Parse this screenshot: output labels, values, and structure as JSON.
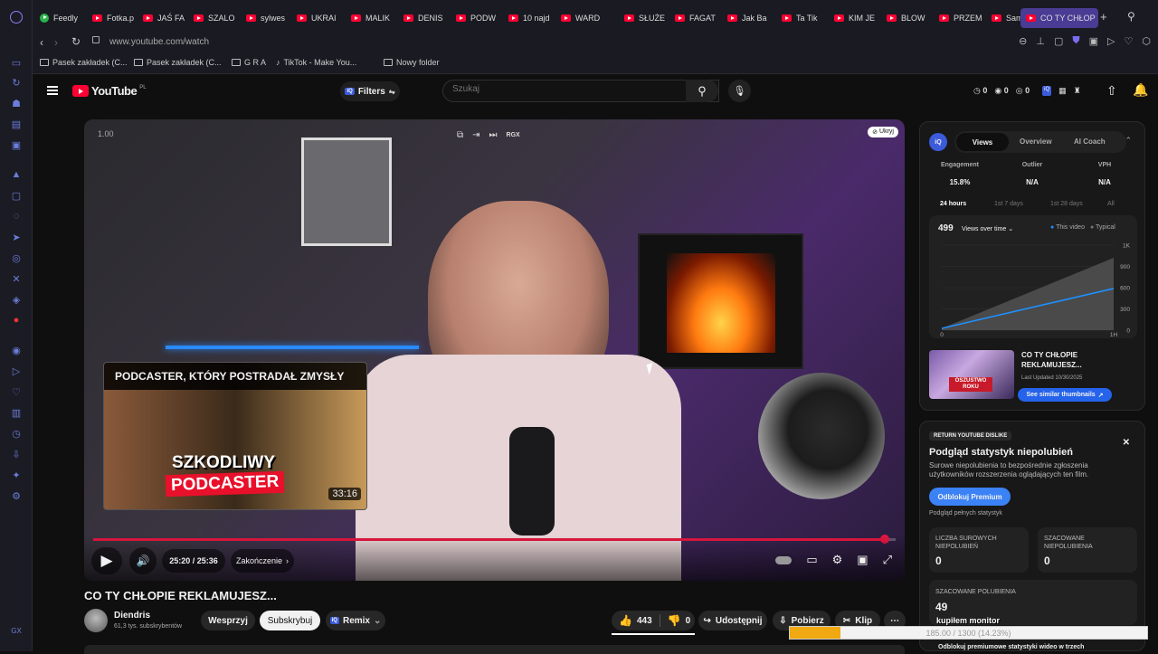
{
  "tabs": [
    {
      "label": "Feedly",
      "color": "#2bb24c"
    },
    {
      "label": "Fotka.p"
    },
    {
      "label": "JAŚ FA"
    },
    {
      "label": "SZALO"
    },
    {
      "label": "sylwes"
    },
    {
      "label": "UKRAI"
    },
    {
      "label": "MALIK"
    },
    {
      "label": "DENIS"
    },
    {
      "label": "PODW"
    },
    {
      "label": "10 najd"
    },
    {
      "label": "WARD"
    },
    {
      "label": "SŁUŻE"
    },
    {
      "label": "FAGAT"
    },
    {
      "label": "Jak Ba"
    },
    {
      "label": "Ta Tik"
    },
    {
      "label": "KIM JE"
    },
    {
      "label": "BLOW"
    },
    {
      "label": "PRZEM"
    },
    {
      "label": "Samot"
    },
    {
      "label": "CO TY CHŁOP"
    }
  ],
  "address": {
    "url": "www.youtube.com/watch"
  },
  "bookmarks": [
    {
      "label": "Pasek zakładek (C..."
    },
    {
      "label": "Pasek zakładek (C..."
    },
    {
      "label": "G R A"
    },
    {
      "label": "TikTok - Make You..."
    },
    {
      "label": "Nowy folder"
    }
  ],
  "header": {
    "logo": "YouTube",
    "region": "PL",
    "filters": "Filters",
    "search_placeholder": "Szukaj",
    "counters": [
      "0",
      "0",
      "0"
    ]
  },
  "player": {
    "speed": "1.00",
    "hide": "Ukryj",
    "rgx": "RGX",
    "card_title": "PODCASTER, KTÓRY POSTRADAŁ ZMYSŁY",
    "card_big1": "SZKODLIWY",
    "card_big2": "PODCASTER",
    "card_duration": "33:16",
    "time": "25:20 / 25:36",
    "chapter": "Zakończenie",
    "progress": 0.986
  },
  "video": {
    "title": "CO TY CHŁOPIE REKLAMUJESZ...",
    "channel": "Diendris",
    "subs": "61,3 tys. subskrybentów",
    "support": "Wesprzyj",
    "subscribe": "Subskrybuj",
    "remix": "Remix",
    "likes": "443",
    "dislikes": "0",
    "share": "Udostępnij",
    "download": "Pobierz",
    "clip": "Klip"
  },
  "vidiq": {
    "tabs": [
      "Views",
      "Overview",
      "AI Coach"
    ],
    "stat_labels": [
      "Engagement",
      "Outlier",
      "VPH"
    ],
    "stat_values": [
      "15.8%",
      "N/A",
      "N/A"
    ],
    "ranges": [
      "24 hours",
      "1st 7 days",
      "1st 28 days",
      "All"
    ],
    "views": "499",
    "views_label": "Views over time",
    "legend_this": "This video",
    "legend_typical": "Typical",
    "y_ticks": [
      "1K",
      "900",
      "600",
      "300",
      "0"
    ],
    "x_ticks": [
      "0",
      "1H"
    ],
    "thumb_title": "CO TY CHŁOPIE REKLAMUJESZ...",
    "thumb_date": "Last Updated 10/30/2025",
    "thumb_badge": "OSZUSTWO ROKU",
    "similar": "See similar thumbnails"
  },
  "dislike": {
    "badge": "RETURN YOUTUBE DISLIKE",
    "title": "Podgląd statystyk niepolubień",
    "desc": "Surowe niepolubienia to bezpośrednie zgłoszenia użytkowników rozszerzenia oglądających ten film.",
    "cta": "Odblokuj Premium",
    "sub": "Podgląd pełnych statystyk",
    "box1_label": "LICZBA SUROWYCH NIEPOLUBIEŃ",
    "box1_value": "0",
    "box2_label": "SZACOWANE NIEPOLUBIENIA",
    "box2_value": "0",
    "box3_label": "SZACOWANE POLUBIENIA",
    "box3_value": "49",
    "note": "kupiłem monitor",
    "footer": "Odblokuj premiumowe statystyki wideo w trzech"
  },
  "overlay": {
    "progress_text": "185.00 / 1300 (14.23%)",
    "fraction": 0.1423
  }
}
